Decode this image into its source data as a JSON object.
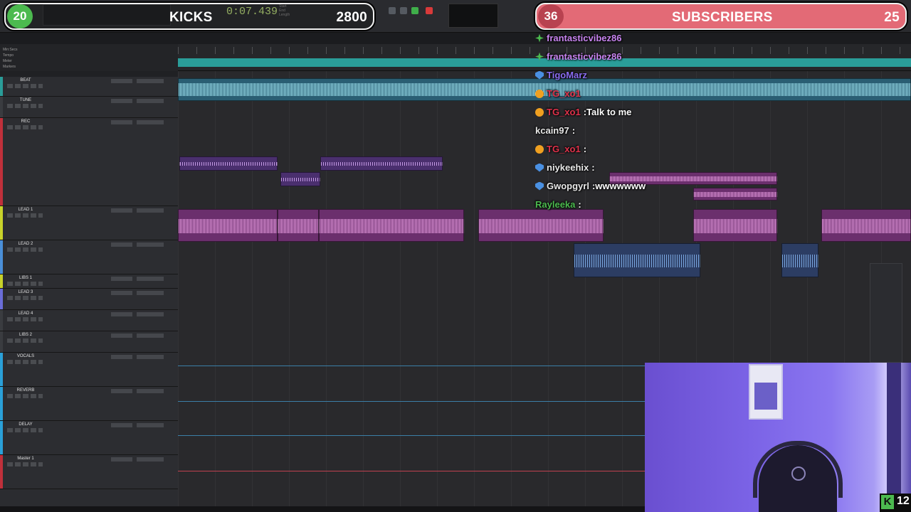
{
  "overlay": {
    "kicks": {
      "count": "20",
      "label": "KICKS",
      "goal": "2800",
      "color": "#4cba4f"
    },
    "subscribers": {
      "count": "36",
      "label": "SUBSCRIBERS",
      "goal": "25",
      "color": "#e36a76"
    },
    "corner_count": "12"
  },
  "transport": {
    "counter": "0:07.439"
  },
  "tracks": [
    {
      "name": "BEAT",
      "color": "#2a9d99"
    },
    {
      "name": "TUNE",
      "color": "#3a3c40"
    },
    {
      "name": "REC",
      "color": "#c0303b"
    },
    {
      "name": "LEAD 1",
      "color": "#c8d22a"
    },
    {
      "name": "LEAD 2",
      "color": "#4a8fd8"
    },
    {
      "name": "LIBS 1",
      "color": "#c8d22a"
    },
    {
      "name": "LEAD 3",
      "color": "#6a6dd8"
    },
    {
      "name": "LEAD 4",
      "color": "#3a3c40"
    },
    {
      "name": "LIBS 2",
      "color": "#3a3c40"
    },
    {
      "name": "VOCALS",
      "color": "#2aa0d8"
    },
    {
      "name": "REVERB",
      "color": "#2aa0d8"
    },
    {
      "name": "DELAY",
      "color": "#2aa0d8"
    },
    {
      "name": "Master 1",
      "color": "#c0303b"
    }
  ],
  "chat": [
    {
      "name": "frantasticvibez86",
      "name_color": "#c884f0",
      "badge": "star",
      "message": ""
    },
    {
      "name": "frantasticvibez86",
      "name_color": "#c884f0",
      "badge": "star",
      "message": ""
    },
    {
      "name": "TigoMarz",
      "name_color": "#8a6cf0",
      "badge": "shield",
      "message": ""
    },
    {
      "name": "TG_xo1",
      "name_color": "#e0314a",
      "badge": "warn",
      "message": ""
    },
    {
      "name": "TG_xo1",
      "name_color": "#e0314a",
      "badge": "warn",
      "message": "Talk to me"
    },
    {
      "name": "kcain97",
      "name_color": "#e8e8e8",
      "badge": "",
      "message": ""
    },
    {
      "name": "TG_xo1",
      "name_color": "#e0314a",
      "badge": "warn",
      "message": ""
    },
    {
      "name": "niykeehix",
      "name_color": "#e8e8e8",
      "badge": "shield",
      "message": ""
    },
    {
      "name": "Gwopgyrl",
      "name_color": "#e8e8e8",
      "badge": "shield",
      "message": "wwwwwww"
    },
    {
      "name": "Rayleeka",
      "name_color": "#4cba4f",
      "badge": "",
      "message": ""
    }
  ],
  "icons": {
    "kicks_icon": "green-circle-icon",
    "subs_icon": "red-circle-icon",
    "corner": "kick-logo-icon"
  }
}
